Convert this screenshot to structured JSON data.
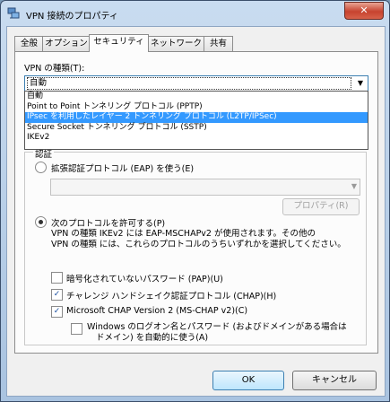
{
  "window": {
    "title": "VPN 接続のプロパティ",
    "close_label": "✕"
  },
  "tabs": [
    "全般",
    "オプション",
    "セキュリティ",
    "ネットワーク",
    "共有"
  ],
  "vpn_type": {
    "label": "VPN の種類(T):",
    "selected": "自動",
    "options": [
      "自動",
      "Point to Point トンネリング プロトコル (PPTP)",
      "IPsec を利用したレイヤー 2 トンネリング プロトコル (L2TP/IPSec)",
      "Secure Socket トンネリング プロトコル (SSTP)",
      "IKEv2"
    ],
    "highlighted_index": 2
  },
  "auth": {
    "group_label": "認証",
    "eap_radio": "拡張認証プロトコル (EAP) を使う(E)",
    "properties_button": "プロパティ(R)",
    "allow_radio": "次のプロトコルを許可する(P)",
    "description_line1": "VPN の種類 IKEv2 には EAP-MSCHAPv2 が使用されます。その他の",
    "description_line2": "VPN の種類 には、これらのプロトコルのうちいずれかを選択してください。",
    "pap": "暗号化されていないパスワード (PAP)(U)",
    "chap": "チャレンジ ハンドシェイク認証プロトコル (CHAP)(H)",
    "mschap": "Microsoft CHAP Version 2 (MS-CHAP v2)(C)",
    "windows_logon_line1": "Windows のログオン名とパスワード (およびドメインがある場合は",
    "windows_logon_line2": "ドメイン) を自動的に使う(A)"
  },
  "buttons": {
    "ok": "OK",
    "cancel": "キャンセル"
  }
}
